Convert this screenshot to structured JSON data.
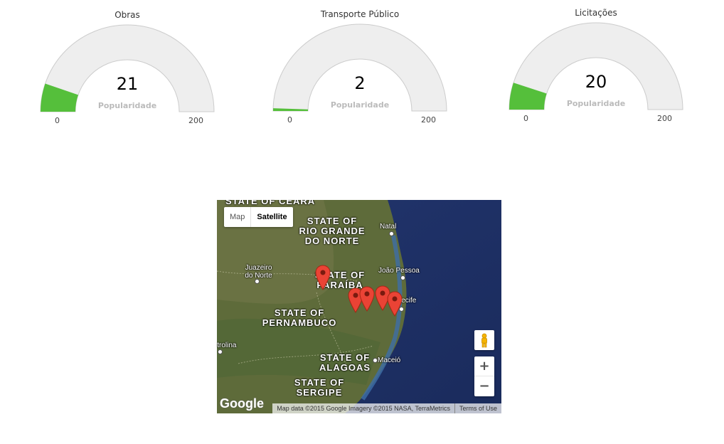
{
  "gauges": [
    {
      "title": "Obras",
      "value": 21,
      "value_text": "21",
      "label": "Popularidade",
      "min": "0",
      "max": "200",
      "min_value": 0,
      "max_value": 200,
      "fill_color": "#55bf3b"
    },
    {
      "title": "Transporte Público",
      "value": 2,
      "value_text": "2",
      "label": "Popularidade",
      "min": "0",
      "max": "200",
      "min_value": 0,
      "max_value": 200,
      "fill_color": "#55bf3b"
    },
    {
      "title": "Licitações",
      "value": 20,
      "value_text": "20",
      "label": "Popularidade",
      "min": "0",
      "max": "200",
      "min_value": 0,
      "max_value": 200,
      "fill_color": "#55bf3b"
    }
  ],
  "colors": {
    "gauge_track": "#eeeeee",
    "gauge_border": "#cccccc",
    "gauge_fill": "#55bf3b",
    "marker": "#ea4335"
  },
  "map": {
    "type_buttons": {
      "map": "Map",
      "satellite": "Satellite",
      "selected": "Satellite"
    },
    "zoom": {
      "in": "+",
      "out": "−"
    },
    "pegman_icon": "pegman-icon",
    "logo": "Google",
    "attribution": "Map data ©2015 Google Imagery ©2015 NASA, TerraMetrics",
    "terms": "Terms of Use",
    "regions": [
      {
        "name": "STATE OF CEARÁ"
      },
      {
        "name": "STATE OF RIO GRANDE DO NORTE"
      },
      {
        "name": "STATE OF PARAÍBA"
      },
      {
        "name": "STATE OF PERNAMBUCO"
      },
      {
        "name": "STATE OF ALAGOAS"
      },
      {
        "name": "STATE OF SERGIPE"
      }
    ],
    "cities": [
      "Natal",
      "Juazeiro do Norte",
      "João Pessoa",
      "Recife",
      "Maceió",
      "Petrolina"
    ],
    "marker_count": 5
  }
}
